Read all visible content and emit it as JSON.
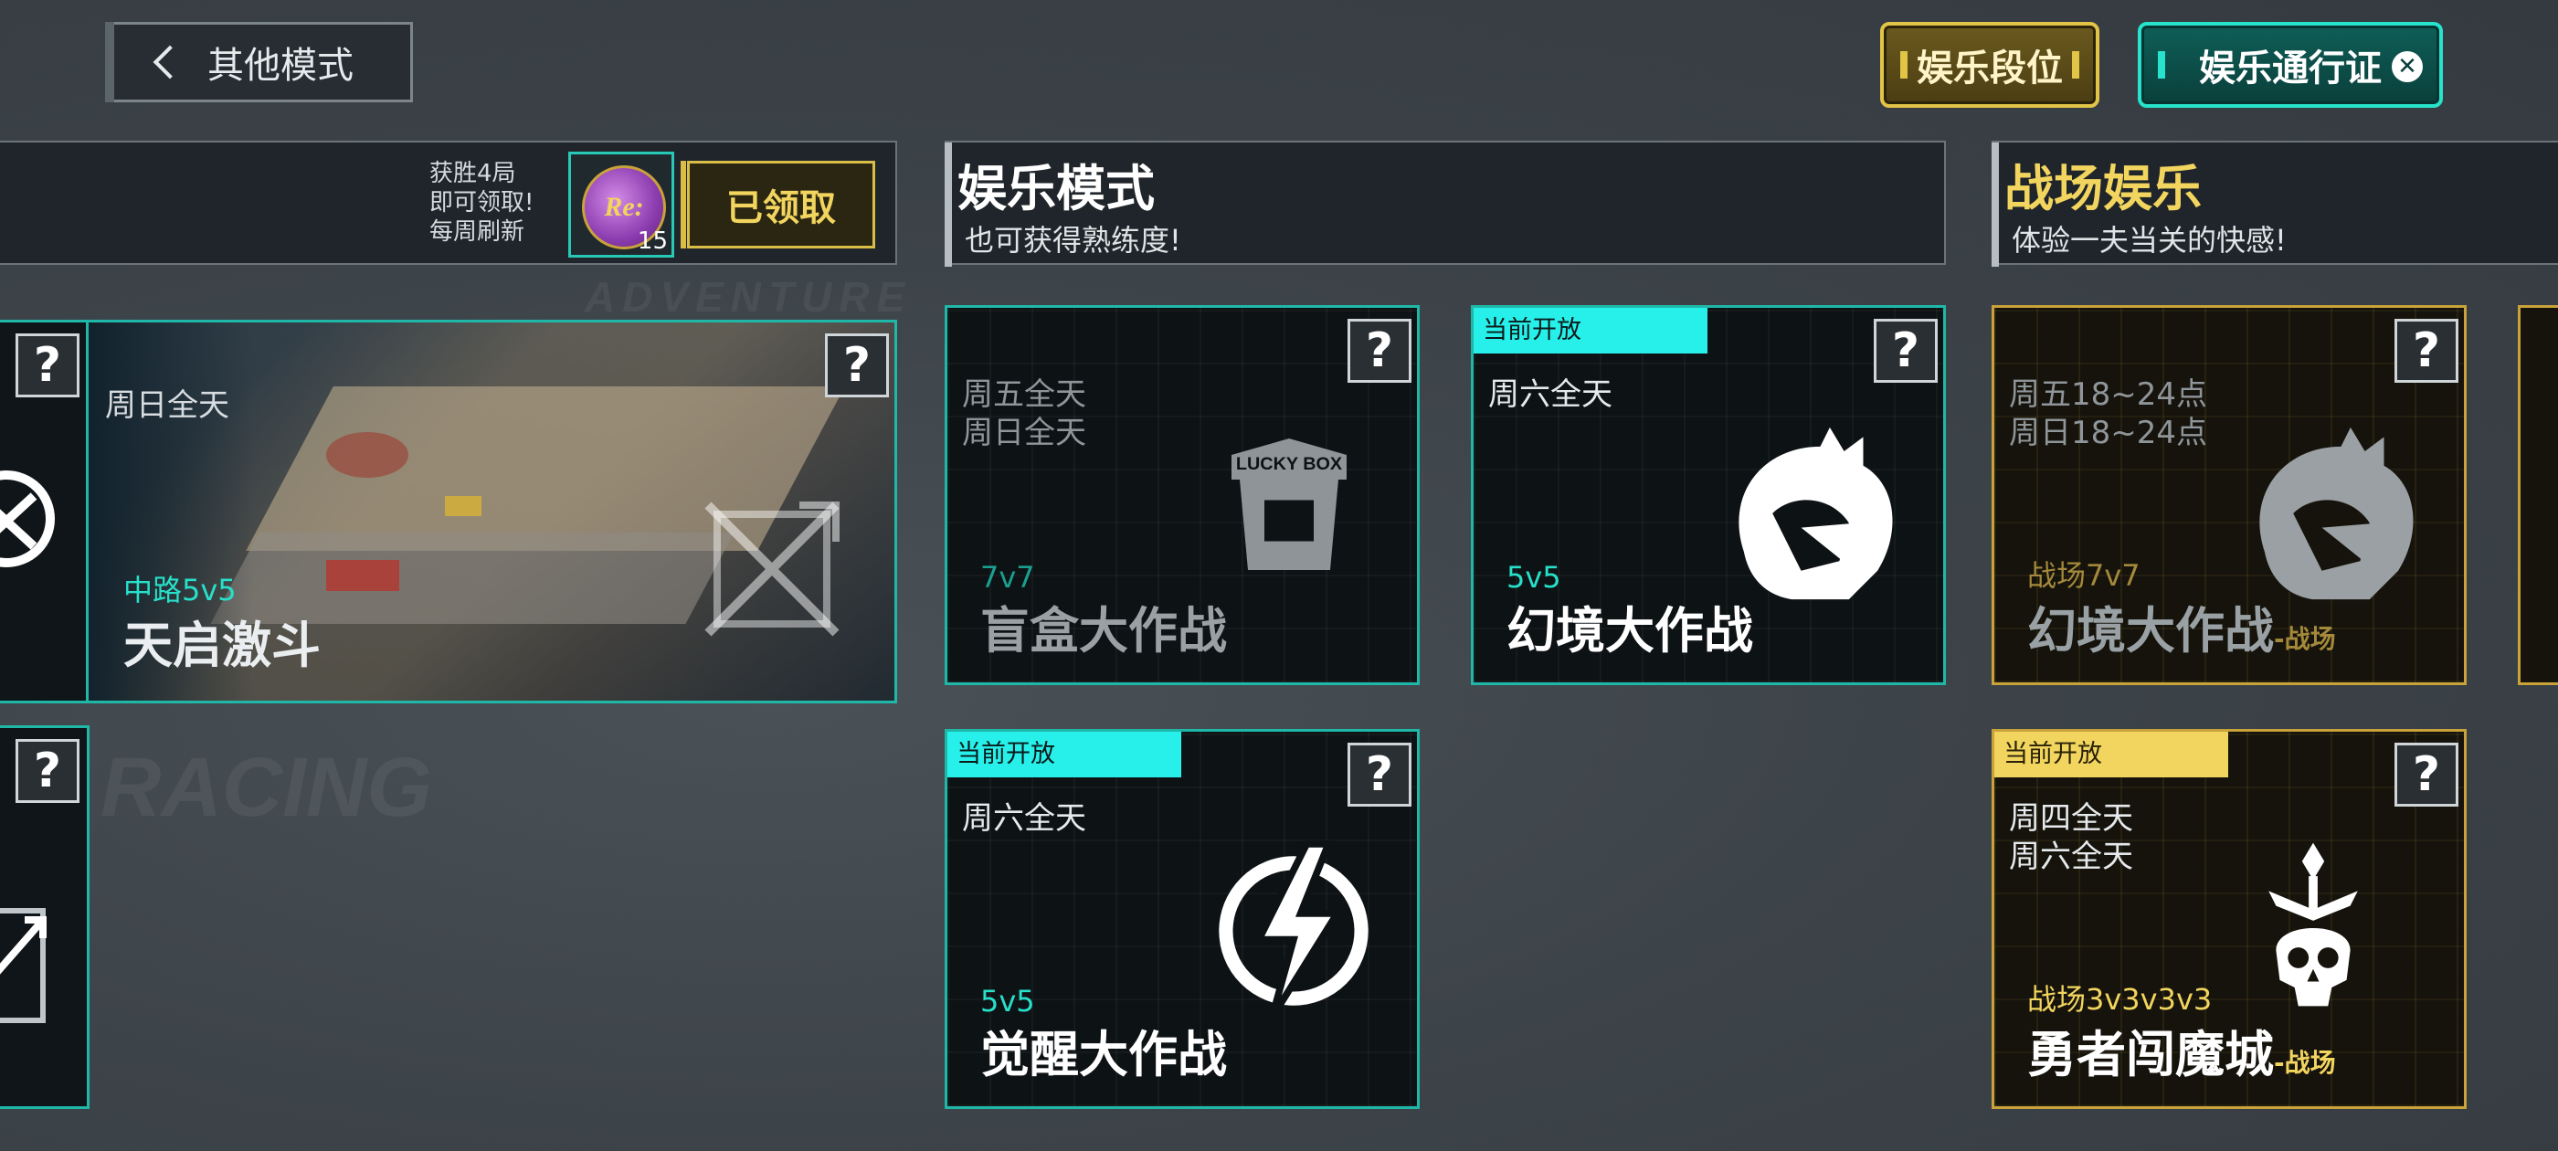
{
  "header": {
    "back_label": "其他模式",
    "rank_label": "娱乐段位",
    "pass_label": "娱乐通行证"
  },
  "reward": {
    "lines": [
      "获胜4局",
      "即可领取!",
      "每周刷新"
    ],
    "coin_text": "Re:",
    "coin_count": "15",
    "claimed_label": "已领取"
  },
  "sections": {
    "fun": {
      "title": "娱乐模式",
      "subtitle": "也可获得熟练度!"
    },
    "battle": {
      "title": "战场娱乐",
      "subtitle": "体验一夫当关的快感!"
    }
  },
  "background_words": [
    "ADVENTURE",
    "RACING"
  ],
  "featured": {
    "schedule": "周日全天",
    "mode": "中路5v5",
    "name": "天启激斗"
  },
  "cards": {
    "blindbox": {
      "schedule": [
        "周五全天",
        "周日全天"
      ],
      "mode": "7v7",
      "name": "盲盒大作战",
      "emblem_text": "LUCKY BOX"
    },
    "illusion": {
      "tag": "当前开放",
      "schedule": [
        "周六全天"
      ],
      "mode": "5v5",
      "name": "幻境大作战"
    },
    "awaken": {
      "tag": "当前开放",
      "schedule": [
        "周六全天"
      ],
      "mode": "5v5",
      "name": "觉醒大作战"
    },
    "illusion_bf": {
      "schedule": [
        "周五18~24点",
        "周日18~24点"
      ],
      "mode": "战场7v7",
      "name": "幻境大作战",
      "suffix": "-战场"
    },
    "demon": {
      "tag": "当前开放",
      "schedule": [
        "周四全天",
        "周六全天"
      ],
      "mode": "战场3v3v3v3",
      "name": "勇者闯魔城",
      "suffix": "-战场"
    }
  },
  "help_glyph": "?",
  "colors": {
    "teal": "#27f0ea",
    "gold": "#f2d55e",
    "card_border": "#1fb8a8"
  }
}
